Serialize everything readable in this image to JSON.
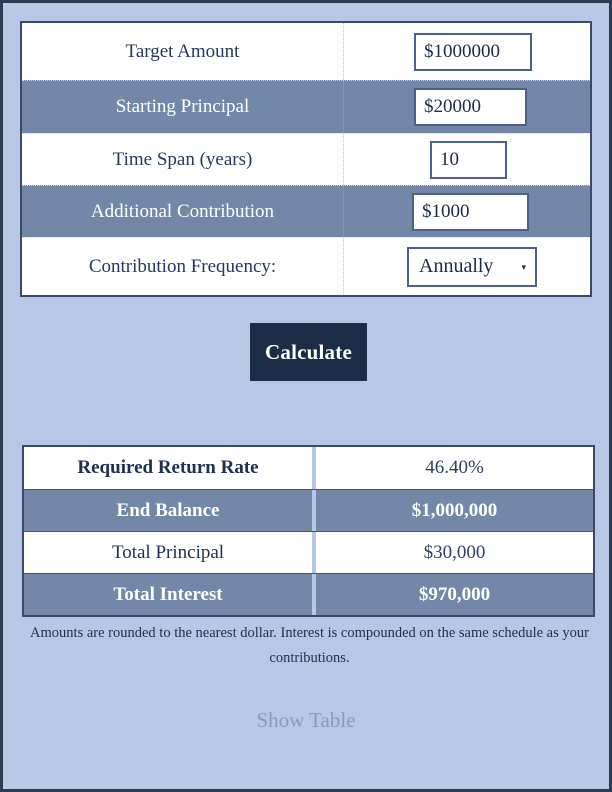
{
  "inputs": {
    "rows": [
      {
        "label": "Target Amount",
        "value": "$1000000",
        "type": "text"
      },
      {
        "label": "Starting Principal",
        "value": "$20000",
        "type": "text"
      },
      {
        "label": "Time Span (years)",
        "value": "10",
        "type": "text"
      },
      {
        "label": "Additional Contribution",
        "value": "$1000",
        "type": "text"
      },
      {
        "label": "Contribution Frequency:",
        "value": "Annually",
        "type": "select"
      }
    ],
    "frequency_options": [
      "Annually"
    ]
  },
  "actions": {
    "calculate_label": "Calculate",
    "show_table_label": "Show Table"
  },
  "results": {
    "rows": [
      {
        "label": "Required Return Rate",
        "value": "46.40%"
      },
      {
        "label": "End Balance",
        "value": "$1,000,000"
      },
      {
        "label": "Total Principal",
        "value": "$30,000"
      },
      {
        "label": "Total Interest",
        "value": "$970,000"
      }
    ]
  },
  "footnote": {
    "text": "Amounts are rounded to the nearest dollar. Interest is compounded on the same schedule as your contributions."
  },
  "colors": {
    "page_background": "#b7c8e6",
    "row_alt": "#7387a8",
    "row_plain": "#ffffff",
    "button_background": "#1b2c47",
    "border": "#3b4a66",
    "text_dark": "#20314f",
    "link": "#8b9cbb"
  },
  "icons": {
    "dropdown_caret": "▾"
  }
}
